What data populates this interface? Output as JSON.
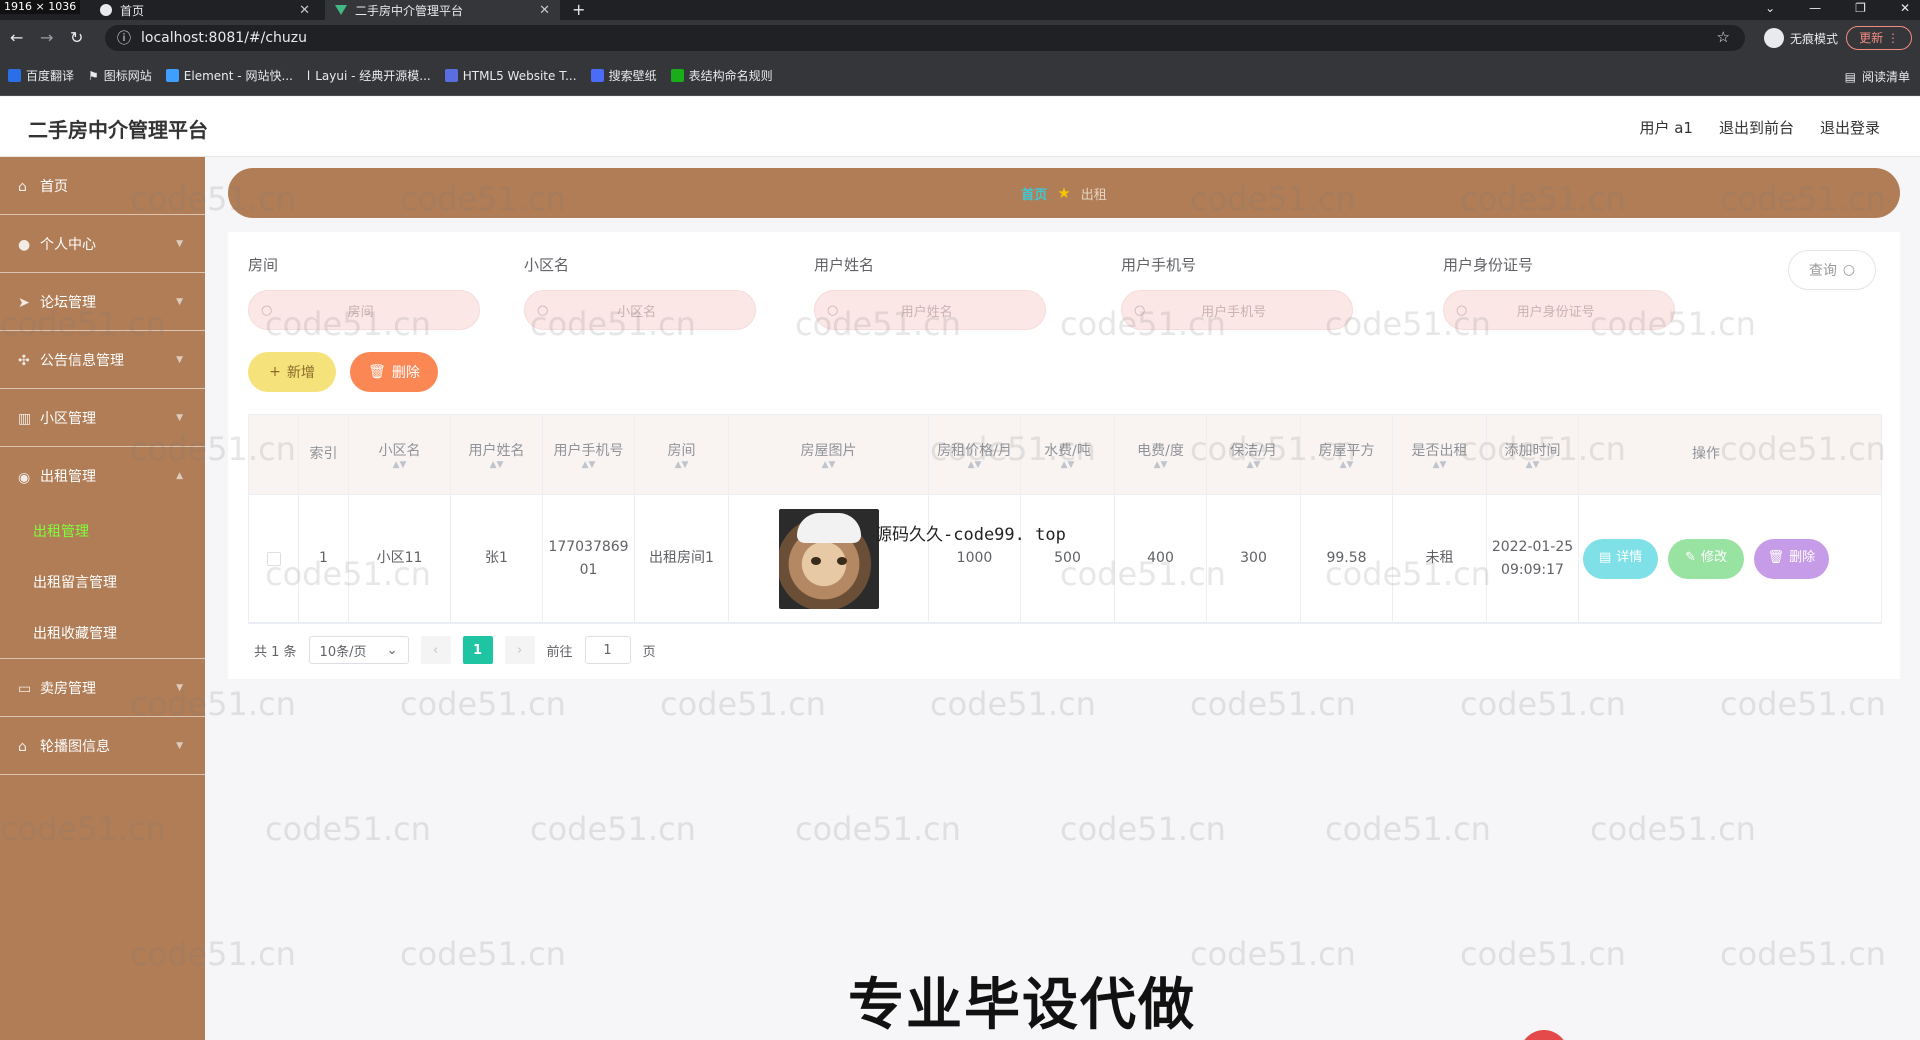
{
  "browser": {
    "dims_label": "1916 × 1036",
    "tabs": [
      {
        "title": "首页"
      },
      {
        "title": "二手房中介管理平台"
      }
    ],
    "url": "localhost:8081/#/chuzu",
    "incognito_label": "无痕模式",
    "update_label": "更新",
    "bookmarks": [
      {
        "label": "百度翻译",
        "color": "#2a6ee8"
      },
      {
        "label": "图标网站",
        "color": "#ffffff"
      },
      {
        "label": "Element - 网站快...",
        "color": "#409eff"
      },
      {
        "label": "Layui - 经典开源模...",
        "color": "#ffffff"
      },
      {
        "label": "HTML5 Website T...",
        "color": "#5b6ee1"
      },
      {
        "label": "搜索壁纸",
        "color": "#4a6cf7"
      },
      {
        "label": "表结构命名规则",
        "color": "#1aad19"
      }
    ],
    "reading_list": "阅读清单"
  },
  "header": {
    "title": "二手房中介管理平台",
    "user": "用户 a1",
    "to_front": "退出到前台",
    "logout": "退出登录"
  },
  "sidebar": {
    "items": [
      {
        "label": "首页"
      },
      {
        "label": "个人中心"
      },
      {
        "label": "论坛管理"
      },
      {
        "label": "公告信息管理"
      },
      {
        "label": "小区管理"
      },
      {
        "label": "出租管理"
      }
    ],
    "sub_items": [
      {
        "label": "出租管理"
      },
      {
        "label": "出租留言管理"
      },
      {
        "label": "出租收藏管理"
      }
    ],
    "items_after": [
      {
        "label": "卖房管理"
      },
      {
        "label": "轮播图信息"
      }
    ]
  },
  "breadcrumb": {
    "home": "首页",
    "current": "出租"
  },
  "search": {
    "fields": [
      {
        "label": "房间",
        "placeholder": "房间"
      },
      {
        "label": "小区名",
        "placeholder": "小区名"
      },
      {
        "label": "用户姓名",
        "placeholder": "用户姓名"
      },
      {
        "label": "用户手机号",
        "placeholder": "用户手机号"
      },
      {
        "label": "用户身份证号",
        "placeholder": "用户身份证号"
      }
    ],
    "query_label": "查询"
  },
  "actions": {
    "add_label": "新增",
    "delete_label": "删除"
  },
  "table": {
    "headers": [
      "索引",
      "小区名",
      "用户姓名",
      "用户手机号",
      "房间",
      "房屋图片",
      "房租价格/月",
      "水费/吨",
      "电费/度",
      "保洁/月",
      "房屋平方",
      "是否出租",
      "添加时间",
      "操作"
    ],
    "rows": [
      {
        "index": "1",
        "community": "小区11",
        "user_name": "张1",
        "phone": "17703786901",
        "room": "出租房间1",
        "rent": "1000",
        "water": "500",
        "electric": "400",
        "cleaning": "300",
        "area": "99.58",
        "rented": "未租",
        "added": "2022-01-25 09:09:17"
      }
    ],
    "op_detail": "详情",
    "op_edit": "修改",
    "op_delete": "删除"
  },
  "overlay_text": "源码久久-code99. top",
  "pagination": {
    "total": "共 1 条",
    "page_size": "10条/页",
    "current": "1",
    "goto_prefix": "前往",
    "goto_value": "1",
    "goto_suffix": "页"
  },
  "watermark": "code51.cn",
  "caption": "专业毕设代做"
}
